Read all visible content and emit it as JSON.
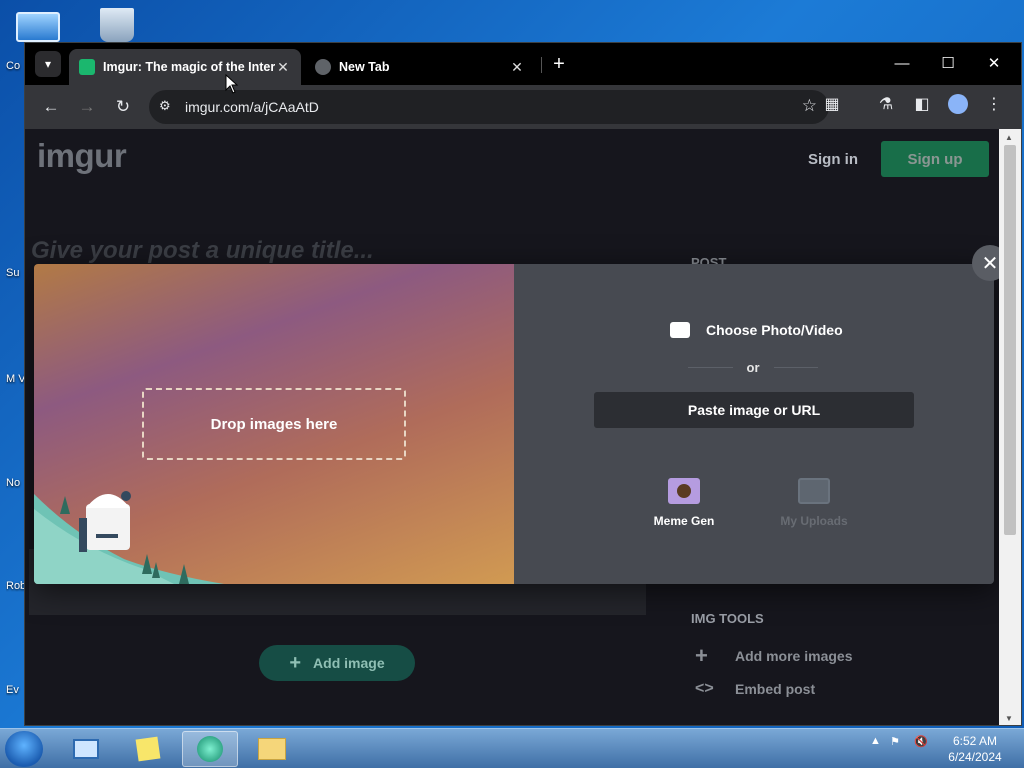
{
  "desktop": {
    "icons": [
      {
        "label": "Co"
      },
      {
        "label": "Su"
      },
      {
        "label": "M Vis"
      },
      {
        "label": "No"
      },
      {
        "label": "Rob"
      },
      {
        "label": "Ev"
      }
    ]
  },
  "browser": {
    "tabs": [
      {
        "title": "Imgur: The magic of the Intern",
        "favicon": "imgur-favicon",
        "active": true
      },
      {
        "title": "New Tab",
        "favicon": "globe-icon",
        "active": false
      }
    ],
    "url": "imgur.com/a/jCAaAtD"
  },
  "page": {
    "logo": "imgur",
    "sign_in": "Sign in",
    "sign_up": "Sign up",
    "title_placeholder": "Give your post a unique title...",
    "post_label": "POST",
    "add_image": "Add image",
    "img_tools_label": "IMG TOOLS",
    "tools": [
      {
        "label": "Add more images",
        "icon": "plus-icon"
      },
      {
        "label": "Embed post",
        "icon": "code-icon"
      }
    ]
  },
  "upload_modal": {
    "drop_text": "Drop images here",
    "choose_label": "Choose Photo/Video",
    "or_text": "or",
    "paste_label": "Paste image or URL",
    "tiles": [
      {
        "label": "Meme Gen",
        "enabled": true
      },
      {
        "label": "My Uploads",
        "enabled": false
      }
    ]
  },
  "taskbar": {
    "time": "6:52 AM",
    "date": "6/24/2024"
  },
  "colors": {
    "signup_green": "#1bb76e",
    "add_image_teal": "#164d45",
    "modal_right_bg": "#474a51"
  }
}
